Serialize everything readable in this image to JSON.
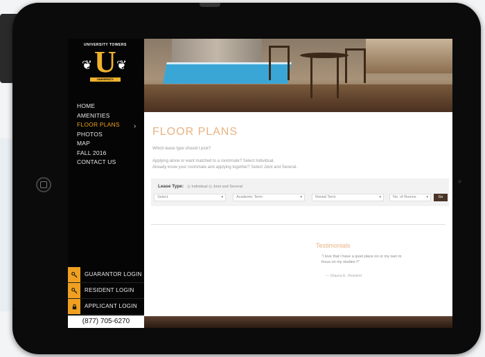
{
  "brand": {
    "arc_text": "UNIVERSITY TOWERS",
    "monogram": "U",
    "banner_text": "UNIVERSITY"
  },
  "nav": {
    "items": [
      {
        "label": "HOME"
      },
      {
        "label": "AMENITIES"
      },
      {
        "label": "FLOOR PLANS",
        "active": true
      },
      {
        "label": "PHOTOS"
      },
      {
        "label": "MAP"
      },
      {
        "label": "FALL 2016"
      },
      {
        "label": "CONTACT US"
      }
    ]
  },
  "logins": {
    "guarantor": "GUARANTOR LOGIN",
    "resident": "RESIDENT LOGIN",
    "applicant": "APPLICANT LOGIN"
  },
  "phone": "(877) 705-6270",
  "page": {
    "title": "FLOOR PLANS",
    "question": "Which lease type should I pick?",
    "help_line_1": "Applying alone or want matched to a roommate? Select Individual.",
    "help_line_2": "Already know your roommate and applying together? Select Joint and Several."
  },
  "filters": {
    "lease_label": "Lease Type:",
    "lease_options": "◎ Individual  ◎ Joint and Several",
    "selects": [
      "Select",
      "Academic Term",
      "Rental Term",
      "No. of Rooms"
    ],
    "go_label": "Go"
  },
  "testimonials": {
    "title": "Testimonials",
    "quote_line_1": "“I love that I have a quiet place on or my own to",
    "quote_line_2": "focus on my studies !!”",
    "author": "— Shauna A., Resident"
  },
  "colors": {
    "accent": "#f0a020",
    "title": "#e8b383",
    "sidebar_bg": "#050505"
  }
}
